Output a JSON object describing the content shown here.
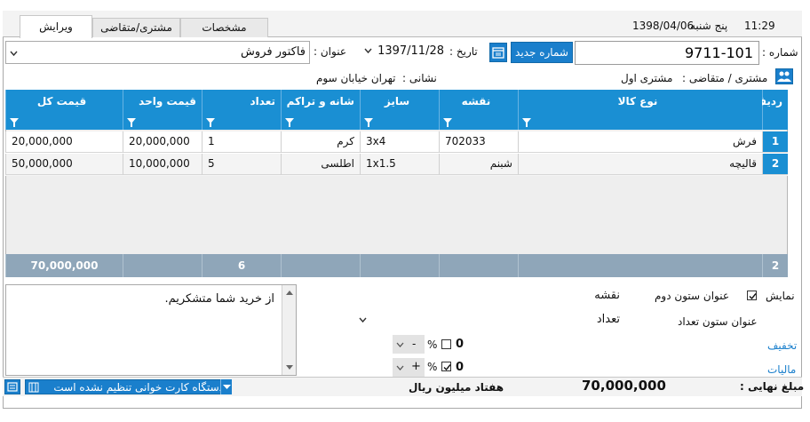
{
  "header": {
    "time": "11:29",
    "weekday": "پنج شنبه",
    "date": "1398/04/06"
  },
  "tabs": [
    {
      "label": "ویرایش",
      "active": true
    },
    {
      "label": "مشتری/متقاضی",
      "active": false
    },
    {
      "label": "مشخصات",
      "active": false
    }
  ],
  "form": {
    "number_label": "شماره :",
    "number_value": "9711-101",
    "new_number_button": "شماره جدید",
    "date_label": "تاریخ :",
    "date_value": "1397/11/28",
    "title_label": "عنوان :",
    "title_value": "فاکتور فروش",
    "customer_label": "مشتری / متقاضی :",
    "customer_value": "مشتری اول",
    "address_label": "نشانی :",
    "address_value": "تهران خیابان سوم"
  },
  "grid": {
    "columns": [
      "ردیف",
      "نوع کالا",
      "نقشه",
      "سایز",
      "شانه و تراکم",
      "تعداد",
      "قیمت واحد",
      "قیمت کل"
    ],
    "rows": [
      {
        "num": "1",
        "type": "فرش",
        "map": "702033",
        "size": "3x4",
        "density": "کرم",
        "qty": "1",
        "unit_price": "20,000,000",
        "total": "20,000,000"
      },
      {
        "num": "2",
        "type": "قالیچه",
        "map": "شبنم",
        "size": "1x1.5",
        "density": "اطلسی",
        "qty": "5",
        "unit_price": "10,000,000",
        "total": "50,000,000"
      }
    ],
    "footer": {
      "count": "2",
      "qty_total": "6",
      "price_total": "70,000,000"
    }
  },
  "options": {
    "show_label": "نمایش",
    "second_col_title_label": "عنوان ستون دوم",
    "second_col_value": "نقشه",
    "count_col_title_label": "عنوان ستون تعداد",
    "count_col_value": "تعداد",
    "discount_link": "تخفیف",
    "tax_link": "مالیات",
    "discount_value": "0",
    "tax_value": "0",
    "percent_sign": "%",
    "minus_sign": "-",
    "plus_sign": "+"
  },
  "notes": {
    "text": "از خرید شما متشکریم."
  },
  "summary": {
    "final_label": "مبلغ نهایی :",
    "final_value": "70,000,000",
    "words": "هفتاد میلیون ریال"
  },
  "status": {
    "card_reader": "دستگاه کارت خوانی تنظیم نشده است"
  },
  "colors": {
    "accent": "#1a8fd3",
    "footer_row": "#8fa6b9"
  }
}
